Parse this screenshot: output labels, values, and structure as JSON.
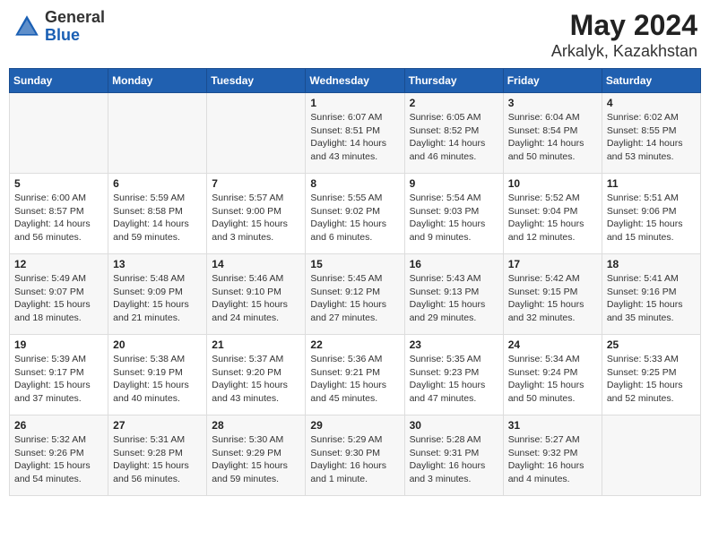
{
  "header": {
    "logo_general": "General",
    "logo_blue": "Blue",
    "title": "May 2024",
    "subtitle": "Arkalyk, Kazakhstan"
  },
  "days_of_week": [
    "Sunday",
    "Monday",
    "Tuesday",
    "Wednesday",
    "Thursday",
    "Friday",
    "Saturday"
  ],
  "weeks": [
    [
      {
        "day": "",
        "info": ""
      },
      {
        "day": "",
        "info": ""
      },
      {
        "day": "",
        "info": ""
      },
      {
        "day": "1",
        "info": "Sunrise: 6:07 AM\nSunset: 8:51 PM\nDaylight: 14 hours\nand 43 minutes."
      },
      {
        "day": "2",
        "info": "Sunrise: 6:05 AM\nSunset: 8:52 PM\nDaylight: 14 hours\nand 46 minutes."
      },
      {
        "day": "3",
        "info": "Sunrise: 6:04 AM\nSunset: 8:54 PM\nDaylight: 14 hours\nand 50 minutes."
      },
      {
        "day": "4",
        "info": "Sunrise: 6:02 AM\nSunset: 8:55 PM\nDaylight: 14 hours\nand 53 minutes."
      }
    ],
    [
      {
        "day": "5",
        "info": "Sunrise: 6:00 AM\nSunset: 8:57 PM\nDaylight: 14 hours\nand 56 minutes."
      },
      {
        "day": "6",
        "info": "Sunrise: 5:59 AM\nSunset: 8:58 PM\nDaylight: 14 hours\nand 59 minutes."
      },
      {
        "day": "7",
        "info": "Sunrise: 5:57 AM\nSunset: 9:00 PM\nDaylight: 15 hours\nand 3 minutes."
      },
      {
        "day": "8",
        "info": "Sunrise: 5:55 AM\nSunset: 9:02 PM\nDaylight: 15 hours\nand 6 minutes."
      },
      {
        "day": "9",
        "info": "Sunrise: 5:54 AM\nSunset: 9:03 PM\nDaylight: 15 hours\nand 9 minutes."
      },
      {
        "day": "10",
        "info": "Sunrise: 5:52 AM\nSunset: 9:04 PM\nDaylight: 15 hours\nand 12 minutes."
      },
      {
        "day": "11",
        "info": "Sunrise: 5:51 AM\nSunset: 9:06 PM\nDaylight: 15 hours\nand 15 minutes."
      }
    ],
    [
      {
        "day": "12",
        "info": "Sunrise: 5:49 AM\nSunset: 9:07 PM\nDaylight: 15 hours\nand 18 minutes."
      },
      {
        "day": "13",
        "info": "Sunrise: 5:48 AM\nSunset: 9:09 PM\nDaylight: 15 hours\nand 21 minutes."
      },
      {
        "day": "14",
        "info": "Sunrise: 5:46 AM\nSunset: 9:10 PM\nDaylight: 15 hours\nand 24 minutes."
      },
      {
        "day": "15",
        "info": "Sunrise: 5:45 AM\nSunset: 9:12 PM\nDaylight: 15 hours\nand 27 minutes."
      },
      {
        "day": "16",
        "info": "Sunrise: 5:43 AM\nSunset: 9:13 PM\nDaylight: 15 hours\nand 29 minutes."
      },
      {
        "day": "17",
        "info": "Sunrise: 5:42 AM\nSunset: 9:15 PM\nDaylight: 15 hours\nand 32 minutes."
      },
      {
        "day": "18",
        "info": "Sunrise: 5:41 AM\nSunset: 9:16 PM\nDaylight: 15 hours\nand 35 minutes."
      }
    ],
    [
      {
        "day": "19",
        "info": "Sunrise: 5:39 AM\nSunset: 9:17 PM\nDaylight: 15 hours\nand 37 minutes."
      },
      {
        "day": "20",
        "info": "Sunrise: 5:38 AM\nSunset: 9:19 PM\nDaylight: 15 hours\nand 40 minutes."
      },
      {
        "day": "21",
        "info": "Sunrise: 5:37 AM\nSunset: 9:20 PM\nDaylight: 15 hours\nand 43 minutes."
      },
      {
        "day": "22",
        "info": "Sunrise: 5:36 AM\nSunset: 9:21 PM\nDaylight: 15 hours\nand 45 minutes."
      },
      {
        "day": "23",
        "info": "Sunrise: 5:35 AM\nSunset: 9:23 PM\nDaylight: 15 hours\nand 47 minutes."
      },
      {
        "day": "24",
        "info": "Sunrise: 5:34 AM\nSunset: 9:24 PM\nDaylight: 15 hours\nand 50 minutes."
      },
      {
        "day": "25",
        "info": "Sunrise: 5:33 AM\nSunset: 9:25 PM\nDaylight: 15 hours\nand 52 minutes."
      }
    ],
    [
      {
        "day": "26",
        "info": "Sunrise: 5:32 AM\nSunset: 9:26 PM\nDaylight: 15 hours\nand 54 minutes."
      },
      {
        "day": "27",
        "info": "Sunrise: 5:31 AM\nSunset: 9:28 PM\nDaylight: 15 hours\nand 56 minutes."
      },
      {
        "day": "28",
        "info": "Sunrise: 5:30 AM\nSunset: 9:29 PM\nDaylight: 15 hours\nand 59 minutes."
      },
      {
        "day": "29",
        "info": "Sunrise: 5:29 AM\nSunset: 9:30 PM\nDaylight: 16 hours\nand 1 minute."
      },
      {
        "day": "30",
        "info": "Sunrise: 5:28 AM\nSunset: 9:31 PM\nDaylight: 16 hours\nand 3 minutes."
      },
      {
        "day": "31",
        "info": "Sunrise: 5:27 AM\nSunset: 9:32 PM\nDaylight: 16 hours\nand 4 minutes."
      },
      {
        "day": "",
        "info": ""
      }
    ]
  ]
}
